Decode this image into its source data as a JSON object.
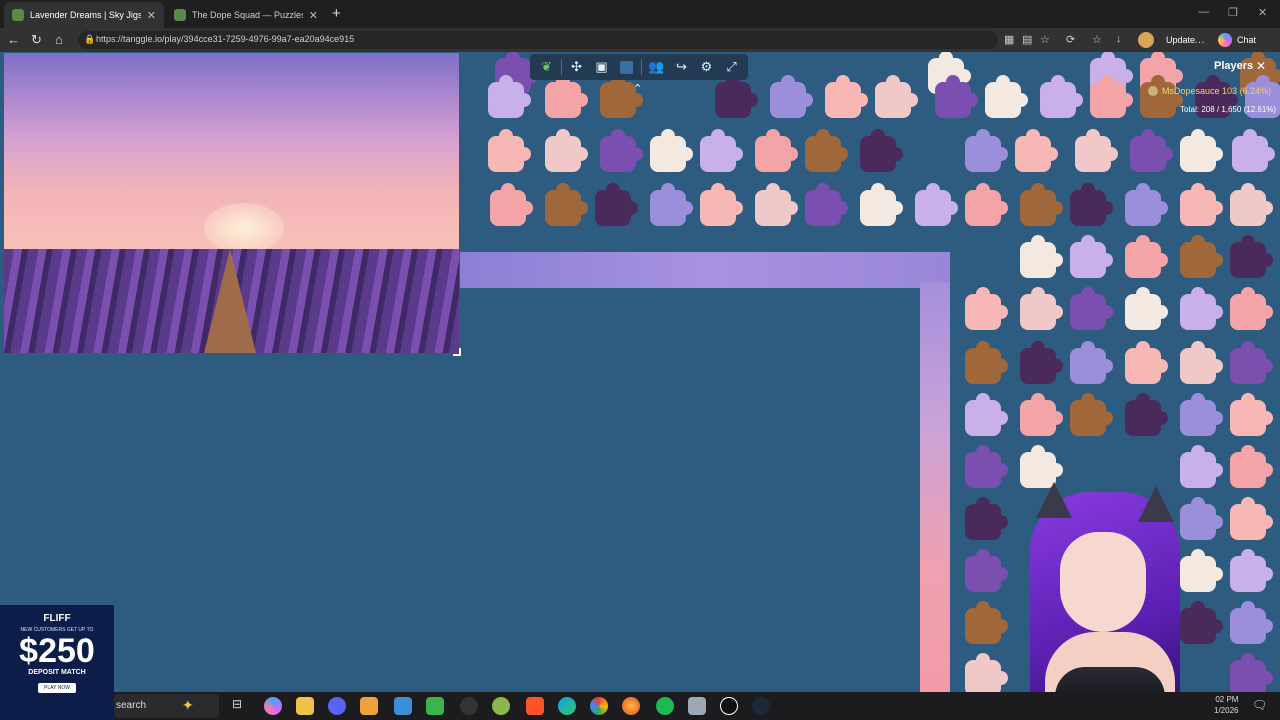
{
  "browser": {
    "tabs": [
      {
        "label": "Lavender Dreams | Sky Jigsaw",
        "active": true
      },
      {
        "label": "The Dope Squad — Puzzles",
        "active": false
      }
    ],
    "url": "https://tanggle.io/play/394cce31-7259-4976-99a7-ea20a94ce915",
    "update_label": "Update",
    "chat_label": "Chat"
  },
  "players": {
    "title": "Players",
    "list": [
      {
        "name": "MsDopesauce",
        "score": "103 (6.24%)"
      }
    ],
    "total": "Total: 208 / 1,650 (12.61%)"
  },
  "ad": {
    "brand": "FLIFF",
    "promo": "NEW CUSTOMERS GET UP TO",
    "amount": "$250",
    "match": "DEPOSIT MATCH",
    "cta": "PLAY NOW"
  },
  "taskbar": {
    "search_label": "search",
    "time": "02 PM",
    "date": "1/2026"
  },
  "colors": {
    "page_bg": "#2e5b80",
    "toolbar_bg": "#223a52",
    "player_name": "#f6d36b"
  }
}
